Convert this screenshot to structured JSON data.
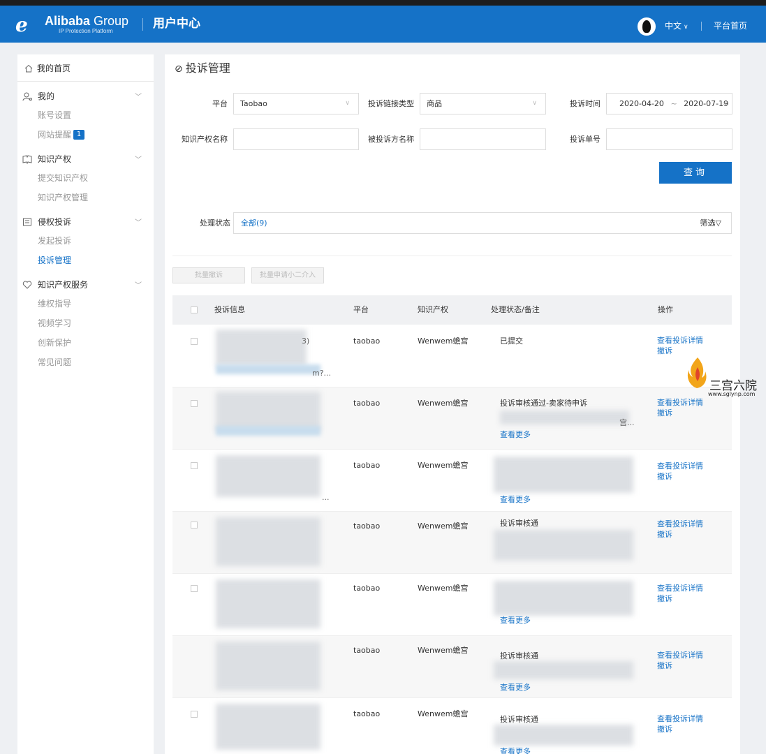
{
  "header": {
    "brand_name": "Alibaba",
    "brand_group": "Group",
    "brand_sub": "IP Protection Platform",
    "title": "用户中心",
    "language": "中文",
    "home_link": "平台首页"
  },
  "sidebar": {
    "home": "我的首页",
    "groups": [
      {
        "title": "我的",
        "icon": "user-icon",
        "items": [
          {
            "label": "账号设置"
          },
          {
            "label": "网站提醒",
            "badge": "1"
          }
        ]
      },
      {
        "title": "知识产权",
        "icon": "book-icon",
        "items": [
          {
            "label": "提交知识产权"
          },
          {
            "label": "知识产权管理"
          }
        ]
      },
      {
        "title": "侵权投诉",
        "icon": "document-icon",
        "items": [
          {
            "label": "发起投诉"
          },
          {
            "label": "投诉管理",
            "active": true
          }
        ]
      },
      {
        "title": "知识产权服务",
        "icon": "heart-icon",
        "items": [
          {
            "label": "维权指导"
          },
          {
            "label": "视频学习"
          },
          {
            "label": "创新保护"
          },
          {
            "label": "常见问题"
          }
        ]
      }
    ]
  },
  "page": {
    "title": "投诉管理"
  },
  "filters": {
    "platform_label": "平台",
    "platform_value": "Taobao",
    "link_type_label": "投诉链接类型",
    "link_type_value": "商品",
    "time_label": "投诉时间",
    "time_start": "2020-04-20",
    "time_sep": "~",
    "time_end": "2020-07-19",
    "ip_name_label": "知识产权名称",
    "ip_name_value": "",
    "respondent_label": "被投诉方名称",
    "respondent_value": "",
    "complaint_no_label": "投诉单号",
    "complaint_no_value": "",
    "query_button": "查询",
    "status_label": "处理状态",
    "status_all": "全部(9)",
    "filter_button": "筛选"
  },
  "batch": {
    "withdraw": "批量撤诉",
    "intervene": "批量申请小二介入"
  },
  "table": {
    "headers": [
      "投诉信息",
      "平台",
      "知识产权",
      "处理状态/备注",
      "操作"
    ],
    "view_details": "查看投诉详情",
    "withdraw": "撤诉",
    "rows": [
      {
        "info_tail": "3)",
        "info_link_tail": "m?...",
        "platform": "taobao",
        "ip": "Wenwem蟾宫",
        "status": "已提交",
        "note_tail": "",
        "more": ""
      },
      {
        "info_tail": "",
        "info_link_tail": "",
        "platform": "taobao",
        "ip": "Wenwem蟾宫",
        "status": "投诉审核通过-卖家待申诉",
        "note_tail": "宫...",
        "more": "查看更多"
      },
      {
        "info_tail": "",
        "info_link_tail": "...",
        "platform": "taobao",
        "ip": "Wenwem蟾宫",
        "status": "",
        "note_tail": "",
        "more": "查看更多"
      },
      {
        "info_tail": "",
        "info_link_tail": "",
        "platform": "taobao",
        "ip": "Wenwem蟾宫",
        "status": "投诉审核通",
        "note_tail": "",
        "more": ""
      },
      {
        "info_tail": "",
        "info_link_tail": "",
        "platform": "taobao",
        "ip": "Wenwem蟾宫",
        "status": "",
        "note_tail": "",
        "more": "查看更多"
      },
      {
        "info_tail": "",
        "info_link_tail": "",
        "platform": "taobao",
        "ip": "Wenwem蟾宫",
        "status": "投诉审核通",
        "note_tail": "",
        "more": "查看更多"
      },
      {
        "info_tail": "",
        "info_link_tail": "",
        "platform": "taobao",
        "ip": "Wenwem蟾宫",
        "status": "投诉审核通",
        "note_tail": "",
        "more": "查看更多"
      }
    ]
  },
  "watermark": {
    "text": "三宫六院",
    "url": "www.sglynp.com"
  }
}
